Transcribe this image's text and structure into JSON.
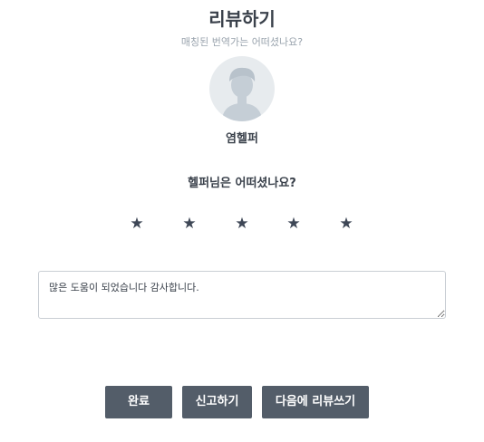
{
  "header": {
    "title": "리뷰하기",
    "subtitle": "매칭된 번역가는 어떠셨나요?"
  },
  "profile": {
    "name": "염헬퍼",
    "avatar_icon": "user-silhouette-icon"
  },
  "rating": {
    "question": "헬퍼님은 어떠셨나요?",
    "stars": [
      "★",
      "★",
      "★",
      "★",
      "★"
    ],
    "value": 5,
    "max": 5
  },
  "review": {
    "value": "많은 도움이 되었습니다 감사합니다."
  },
  "actions": {
    "done_label": "완료",
    "report_label": "신고하기",
    "later_label": "다음에 리뷰쓰기"
  },
  "colors": {
    "button_bg": "#535d69",
    "star": "#3e4756",
    "subtitle": "#99a3ad",
    "avatar_bg": "#e7ebee",
    "avatar_figure": "#c5ced6"
  }
}
